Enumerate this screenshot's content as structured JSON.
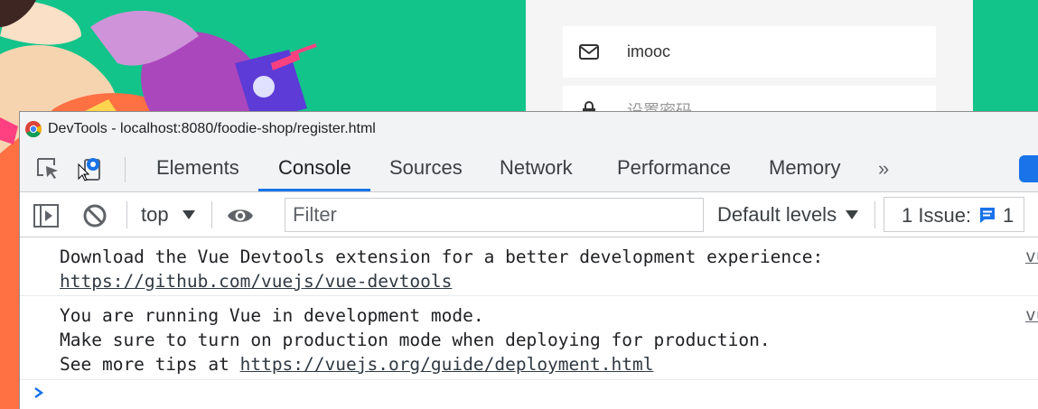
{
  "page": {
    "fields": [
      {
        "icon": "mail-icon",
        "text": "imooc"
      },
      {
        "icon": "lock-icon",
        "text": "设置密码"
      }
    ],
    "colors": {
      "background": "#13c48a",
      "card": "#f5f5f5"
    }
  },
  "devtools": {
    "title": "DevTools - localhost:8080/foodie-shop/register.html",
    "tabs": [
      "Elements",
      "Console",
      "Sources",
      "Network",
      "Performance",
      "Memory"
    ],
    "active_tab": "Console",
    "more_tabs": "»",
    "toolbar": {
      "context": "top",
      "filter_placeholder": "Filter",
      "levels": "Default levels",
      "issues_label": "1 Issue:",
      "issues_count": "1"
    },
    "messages": [
      {
        "lines": [
          "Download the Vue Devtools extension for a better development experience:"
        ],
        "link": "https://github.com/vuejs/vue-devtools",
        "source": "vu"
      },
      {
        "lines": [
          "You are running Vue in development mode.",
          "Make sure to turn on production mode when deploying for production."
        ],
        "prefix": "See more tips at ",
        "link": "https://vuejs.org/guide/deployment.html",
        "source": "vu"
      }
    ],
    "colors": {
      "accent": "#1a73e8",
      "panel": "#f1f3f4",
      "border": "#cbcdd1"
    }
  }
}
